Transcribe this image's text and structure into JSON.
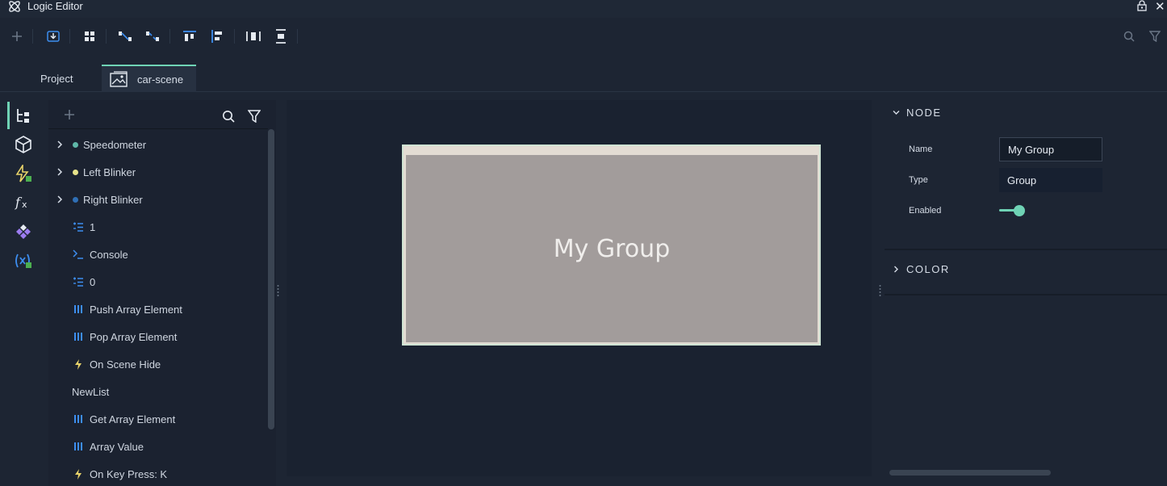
{
  "window": {
    "title": "Logic Editor"
  },
  "tabs": [
    {
      "label": "Project"
    },
    {
      "label": "car-scene"
    }
  ],
  "tree": {
    "items": [
      {
        "label": "Speedometer",
        "kind": "expandable",
        "dot_color": "#5fb8a9"
      },
      {
        "label": "Left Blinker",
        "kind": "expandable",
        "dot_color": "#e6e28a"
      },
      {
        "label": "Right Blinker",
        "kind": "expandable",
        "dot_color": "#2f6fb5"
      },
      {
        "label": "1",
        "kind": "icon",
        "icon": "number-icon"
      },
      {
        "label": "Console",
        "kind": "icon",
        "icon": "console-icon"
      },
      {
        "label": "0",
        "kind": "icon",
        "icon": "number-icon"
      },
      {
        "label": "Push Array Element",
        "kind": "icon",
        "icon": "array-icon"
      },
      {
        "label": "Pop Array Element",
        "kind": "icon",
        "icon": "array-icon"
      },
      {
        "label": "On Scene Hide",
        "kind": "icon",
        "icon": "lightning-icon"
      },
      {
        "label": "NewList",
        "kind": "plain"
      },
      {
        "label": "Get Array Element",
        "kind": "icon",
        "icon": "array-icon"
      },
      {
        "label": "Array Value",
        "kind": "icon",
        "icon": "array-icon"
      },
      {
        "label": "On Key Press: K",
        "kind": "icon",
        "icon": "lightning-icon"
      }
    ]
  },
  "canvas": {
    "group": {
      "title": "My Group"
    }
  },
  "inspector": {
    "node_section": "NODE",
    "color_section": "COLOR",
    "name_label": "Name",
    "name_value": "My Group",
    "type_label": "Type",
    "type_value": "Group",
    "enabled_label": "Enabled",
    "enabled": true
  },
  "colors": {
    "accent": "#6fd3b5",
    "icon_blue": "#3d8ef0",
    "icon_yellow": "#e8d36a"
  }
}
